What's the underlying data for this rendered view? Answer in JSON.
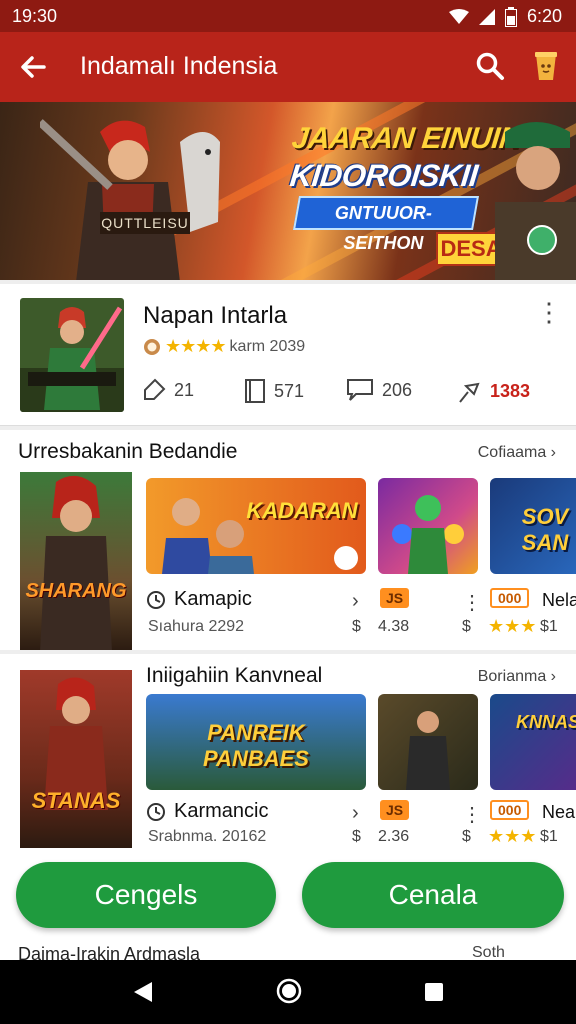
{
  "status_bar": {
    "time": "19:30",
    "clock": "6:20"
  },
  "app_bar": {
    "title": "Indamalı Indensia"
  },
  "hero": {
    "title_line1": "JAARAN EINUIN",
    "title_line2": "KIDOROISKII",
    "subtitle": "GNTUUOR-SEITHON",
    "cta": "DESAN",
    "tag": "QUTTLEISU"
  },
  "detail": {
    "name": "Napan Intarla",
    "rating_stars": "★★★★",
    "rating_text": "karm 2039",
    "stats": [
      {
        "icon": "tag-icon",
        "value": "21"
      },
      {
        "icon": "book-icon",
        "value": "571"
      },
      {
        "icon": "chat-icon",
        "value": "206"
      },
      {
        "icon": "pin-icon",
        "value": "1383"
      }
    ]
  },
  "section1": {
    "heading": "Urresbakanin Bedandie",
    "link": "Cofiaama",
    "poster_label": "SHARANG",
    "tile1_label": "KADARAN",
    "tile3_label": "SOV SAN",
    "item_title": "Kamapic",
    "item_sub": "Sıahura 2292",
    "price1": "4.38",
    "badge1": "JS",
    "badge2": "000",
    "name2": "Nela",
    "stars2": "★★★",
    "price2": "$1"
  },
  "section2": {
    "heading": "Iniigahiin Kanvneal",
    "link": "Borianma",
    "poster_label": "STANAS",
    "tile1_label": "PANREIK PANBAES",
    "tile3_label": "KNNAS",
    "item_title": "Karmancic",
    "item_sub": "Srabnma. 20162",
    "price1": "2.36",
    "badge1": "JS",
    "badge2": "000",
    "name2": "Neal",
    "stars2": "★★★",
    "price2": "$1"
  },
  "buttons": {
    "left": "Cengels",
    "right": "Cenala"
  },
  "peek": {
    "left": "Daima-Irakin Ardmasla",
    "right": "Soth"
  },
  "colors": {
    "app_bar": "#b8241a",
    "status_bar": "#8e1a12",
    "button_green": "#1f9b3e",
    "star": "#f4b400",
    "badge_orange": "#ff8f1f"
  }
}
